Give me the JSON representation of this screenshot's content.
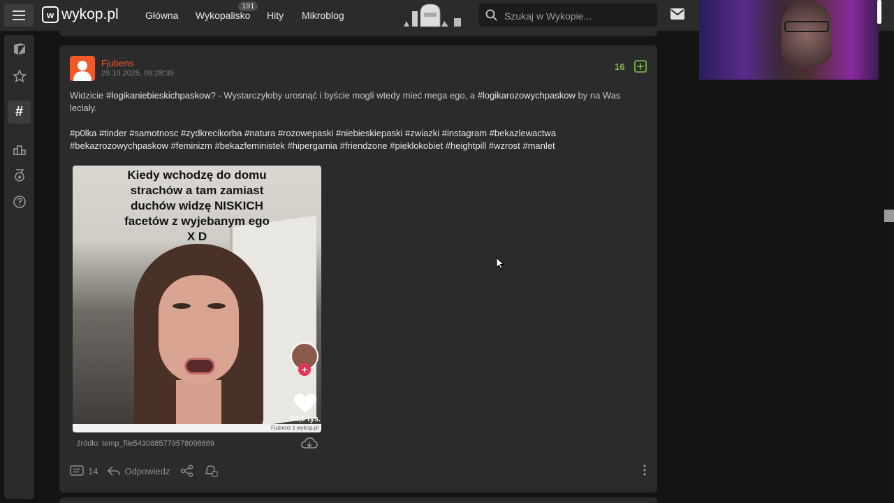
{
  "header": {
    "logo_text": "wykop.pl",
    "logo_mark": "w",
    "nav": [
      {
        "label": "Główna"
      },
      {
        "label": "Wykopalisko",
        "badge": "191"
      },
      {
        "label": "Hity"
      },
      {
        "label": "Mikroblog"
      }
    ],
    "search_placeholder": "Szukaj w Wykopie...",
    "icons": [
      "menu-icon",
      "mail-icon",
      "search-icon"
    ]
  },
  "sidebar": {
    "items": [
      {
        "icon": "newspaper-icon",
        "active": false
      },
      {
        "icon": "star-icon",
        "active": false
      },
      {
        "icon": "hashtag-icon",
        "active": true
      },
      {
        "icon": "podium-icon",
        "active": false
      },
      {
        "icon": "medal-icon",
        "active": false
      },
      {
        "icon": "help-icon",
        "active": false
      }
    ]
  },
  "post": {
    "author": "Fjubens",
    "date": "29.10.2025, 08:28:39",
    "votes": "16",
    "text": {
      "t1": "Widzicie ",
      "tag1": "#logikaniebieskichpaskow",
      "t2": "? - Wystarczyłoby urosnąć i byście mogli wtedy mieć mega ego, a ",
      "tag2": "#logikarozowychpaskow",
      "t3": " by na Was leciały."
    },
    "tags": [
      "#p0lka",
      "#tinder",
      "#samotnosc",
      "#zydkrecikorba",
      "#natura",
      "#rozowepaski",
      "#niebieskiepaski",
      "#zwiazki",
      "#instagram",
      "#bekazlewactwa",
      "#bekazrozowychpaskow",
      "#feminizm",
      "#bekazfeministek",
      "#hipergamia",
      "#friendzone",
      "#pieklokobiet",
      "#heightpill",
      "#wzrost",
      "#manlet"
    ],
    "image": {
      "caption_lines": [
        "Kiedy wchodzę do domu",
        "strachów  a tam zamiast",
        "duchów widzę NISKICH",
        "facetów z wyjebanym  ego",
        "X D"
      ],
      "likes": "24,9 tys.",
      "watermark": "Fjubens  z  wykop.pl"
    },
    "source": "źródło: temp_file5430885779578098669",
    "comments_count": "14",
    "reply_label": "Odpowiedz"
  },
  "colors": {
    "accent": "#f05a28",
    "vote_green": "#7fbf4a",
    "background": "#141414",
    "card": "#2b2b2b"
  }
}
